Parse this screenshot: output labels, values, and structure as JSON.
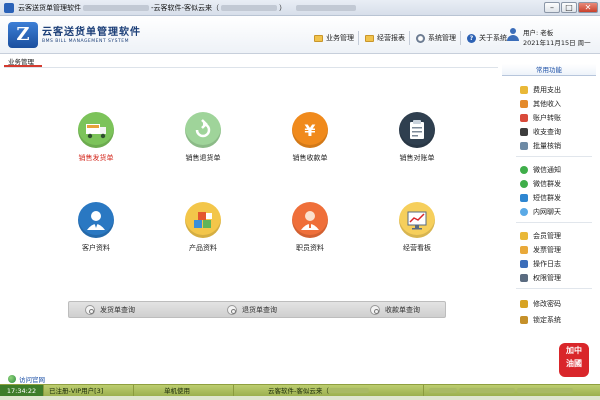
{
  "window": {
    "title_prefix": "云客送货单管理软件",
    "title_middle": "-云客软件-客似云来（",
    "title_suffix": "）",
    "buttons": {
      "minimize": "–",
      "maximize": "□",
      "close": "✕"
    }
  },
  "brand": {
    "name_cn": "云客送货单管理软件",
    "name_en": "BMS BILL MANAGEMENT SYSTEM",
    "logo_letter": "Z"
  },
  "topnav": [
    {
      "label": "业务管理",
      "icon": "folder-icon"
    },
    {
      "label": "经营报表",
      "icon": "folder-icon"
    },
    {
      "label": "系统管理",
      "icon": "gear-icon"
    },
    {
      "label": "关于系统",
      "icon": "help-icon"
    }
  ],
  "user": {
    "line1": "用户: 老板",
    "line2": "2021年11月15日 周一"
  },
  "section_tab": "业务管理",
  "tiles": [
    {
      "label": "销售发货单",
      "icon": "delivery-truck-icon",
      "color": "#7cc35a",
      "active": true
    },
    {
      "label": "销售退货单",
      "icon": "return-refresh-icon",
      "color": "#9fd49a",
      "active": false
    },
    {
      "label": "销售收款单",
      "icon": "yen-icon",
      "color": "#f08a1c",
      "active": false
    },
    {
      "label": "销售对账单",
      "icon": "clipboard-icon",
      "color": "#2f3f4f",
      "active": false
    },
    {
      "label": "客户资料",
      "icon": "customer-icon",
      "color": "#2a78c2",
      "active": false
    },
    {
      "label": "产品资料",
      "icon": "boxes-icon",
      "color": "#f3c64a",
      "active": false
    },
    {
      "label": "职员资料",
      "icon": "staff-icon",
      "color": "#ef6f3a",
      "active": false
    },
    {
      "label": "经营看板",
      "icon": "dashboard-chart-icon",
      "color": "#f6cf5c",
      "active": false
    }
  ],
  "search": [
    {
      "label": "发货单查询"
    },
    {
      "label": "退货单查询"
    },
    {
      "label": "收款单查询"
    }
  ],
  "rpanel": {
    "title": "常用功能",
    "items": [
      {
        "label": "费用支出",
        "color": "#e9b838"
      },
      {
        "label": "其他收入",
        "color": "#e48a2b"
      },
      {
        "label": "账户转账",
        "color": "#d94a3a"
      },
      {
        "label": "收支查询",
        "color": "#3d3d3d"
      },
      {
        "label": "批量核销",
        "color": "#6d8aa5"
      },
      {
        "label": "微信通知",
        "color": "#3fae4a"
      },
      {
        "label": "微信群发",
        "color": "#3fae4a"
      },
      {
        "label": "短信群发",
        "color": "#2e86d1"
      },
      {
        "label": "内网聊天",
        "color": "#5aa9e6"
      },
      {
        "label": "会员管理",
        "color": "#e9b838"
      },
      {
        "label": "发票管理",
        "color": "#e9a93a"
      },
      {
        "label": "操作日志",
        "color": "#3b6db9"
      },
      {
        "label": "权限管理",
        "color": "#5a6b80"
      },
      {
        "label": "修改密码",
        "color": "#d7a323"
      },
      {
        "label": "锁定系统",
        "color": "#c5902a"
      }
    ]
  },
  "visit_link": "访问官网",
  "badge": {
    "line1": "加中",
    "line2": "油國"
  },
  "status": {
    "time": "17:34:22",
    "registered": "已注册-VIP用户[3]",
    "mode": "单机使用",
    "company": "云客软件-客似云来（"
  }
}
